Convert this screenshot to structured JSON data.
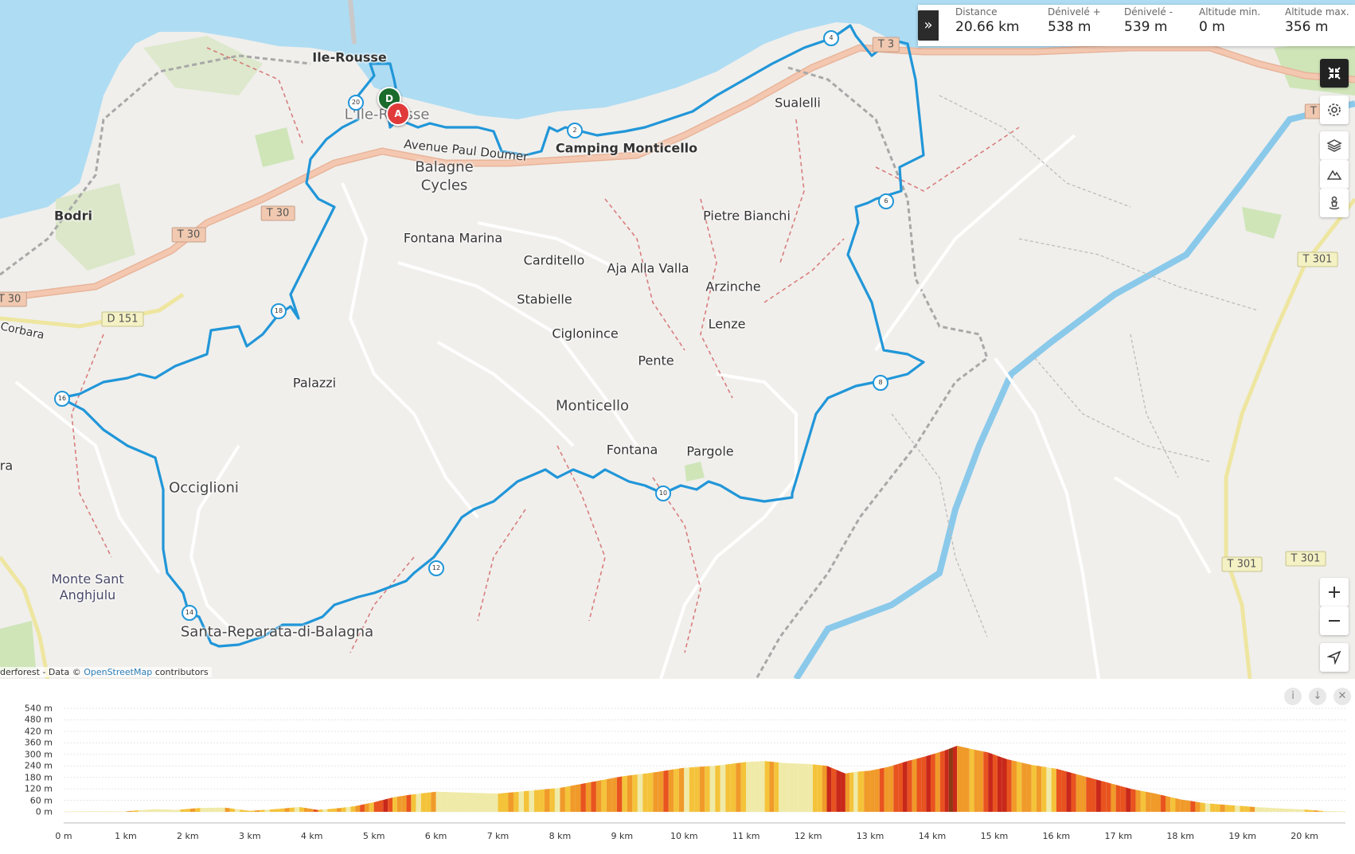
{
  "stats": [
    {
      "label": "Distance",
      "value": "20.66 km"
    },
    {
      "label": "Dénivelé +",
      "value": "538 m"
    },
    {
      "label": "Dénivelé -",
      "value": "539 m"
    },
    {
      "label": "Altitude min.",
      "value": "0 m"
    },
    {
      "label": "Altitude max.",
      "value": "356 m"
    }
  ],
  "places": [
    {
      "name": "Ile-Rousse",
      "style": "bold"
    },
    {
      "name": "L'Île-Rousse",
      "style": "big"
    },
    {
      "name": "Bodri",
      "style": "bold"
    },
    {
      "name": "Balagne",
      "style": "big"
    },
    {
      "name": "Cycles",
      "style": "big"
    },
    {
      "name": "Camping Monticello",
      "style": "bold"
    },
    {
      "name": "Sualelli",
      "style": ""
    },
    {
      "name": "Pietre Bianchi",
      "style": ""
    },
    {
      "name": "Fontana Marina",
      "style": ""
    },
    {
      "name": "Carditello",
      "style": ""
    },
    {
      "name": "Aja Alla Valla",
      "style": ""
    },
    {
      "name": "Stabielle",
      "style": ""
    },
    {
      "name": "Arzinche",
      "style": ""
    },
    {
      "name": "Lenze",
      "style": ""
    },
    {
      "name": "Ciglonince",
      "style": ""
    },
    {
      "name": "Pente",
      "style": ""
    },
    {
      "name": "Palazzi",
      "style": ""
    },
    {
      "name": "Monticello",
      "style": "big"
    },
    {
      "name": "Fontana",
      "style": ""
    },
    {
      "name": "Pargole",
      "style": ""
    },
    {
      "name": "Occiglioni",
      "style": "big"
    },
    {
      "name": "Monte Sant Anghjulu",
      "style": "purple"
    },
    {
      "name": "Santa-Reparata-di-Balagna",
      "style": "big"
    },
    {
      "name": "Corbara",
      "style": ""
    },
    {
      "name": "ra",
      "style": ""
    }
  ],
  "street": "Avenue Paul Doumer",
  "road_signs": [
    "T 30",
    "T 30",
    "T 30",
    "D 151",
    "T 301",
    "T 301",
    "T 301",
    "T 3",
    "T 3"
  ],
  "km_markers": [
    "2",
    "4",
    "6",
    "8",
    "10",
    "12",
    "14",
    "16",
    "18",
    "20"
  ],
  "markers": {
    "depart": "D",
    "arrivee": "A"
  },
  "attribution": {
    "prefix": "derforest - Data © ",
    "link": "OpenStreetMap",
    "suffix": " contributors"
  },
  "map_controls": [
    "collapse-icon",
    "settings-icon",
    "layers-icon",
    "terrain-icon",
    "street-view-icon",
    "zoom-in-icon",
    "zoom-out-icon",
    "locate-icon"
  ],
  "profile_tools": [
    "info-icon",
    "download-icon",
    "close-icon"
  ],
  "chart_data": {
    "type": "area",
    "title": "",
    "xlabel": "",
    "ylabel": "",
    "x_ticks": [
      "0 m",
      "1 km",
      "2 km",
      "3 km",
      "4 km",
      "5 km",
      "6 km",
      "7 km",
      "8 km",
      "9 km",
      "10 km",
      "11 km",
      "12 km",
      "13 km",
      "14 km",
      "15 km",
      "16 km",
      "17 km",
      "18 km",
      "19 km",
      "20 km"
    ],
    "y_ticks": [
      "540 m",
      "480 m",
      "420 m",
      "360 m",
      "300 m",
      "240 m",
      "180 m",
      "120 m",
      "60 m",
      "0 m"
    ],
    "xlim": [
      0,
      20.66
    ],
    "ylim": [
      0,
      540
    ],
    "x": [
      0,
      0.5,
      1,
      1.2,
      1.5,
      1.8,
      2.2,
      2.6,
      3.0,
      3.4,
      3.8,
      4.1,
      4.4,
      4.7,
      5.0,
      5.3,
      5.6,
      6.0,
      6.5,
      7.0,
      7.5,
      8.0,
      8.5,
      9.0,
      9.5,
      10.0,
      10.5,
      11.0,
      11.3,
      11.6,
      12.0,
      12.3,
      12.6,
      12.8,
      13.0,
      13.3,
      13.6,
      13.9,
      14.2,
      14.4,
      14.6,
      14.9,
      15.2,
      15.6,
      16.0,
      16.4,
      16.8,
      17.2,
      17.6,
      18.0,
      18.4,
      18.8,
      19.2,
      19.6,
      20.0,
      20.3,
      20.66
    ],
    "y": [
      2,
      3,
      2,
      8,
      14,
      10,
      20,
      22,
      5,
      14,
      25,
      10,
      18,
      30,
      50,
      75,
      90,
      105,
      100,
      95,
      110,
      125,
      155,
      185,
      205,
      230,
      240,
      260,
      265,
      255,
      250,
      240,
      200,
      210,
      215,
      235,
      265,
      290,
      320,
      345,
      330,
      310,
      275,
      245,
      225,
      190,
      155,
      120,
      95,
      65,
      45,
      35,
      25,
      18,
      12,
      4,
      2
    ],
    "grade_colors": [
      "#f0eaa8",
      "#f4c33a",
      "#f09a2a",
      "#e8531f",
      "#c8281a",
      "#8c3a14"
    ]
  }
}
